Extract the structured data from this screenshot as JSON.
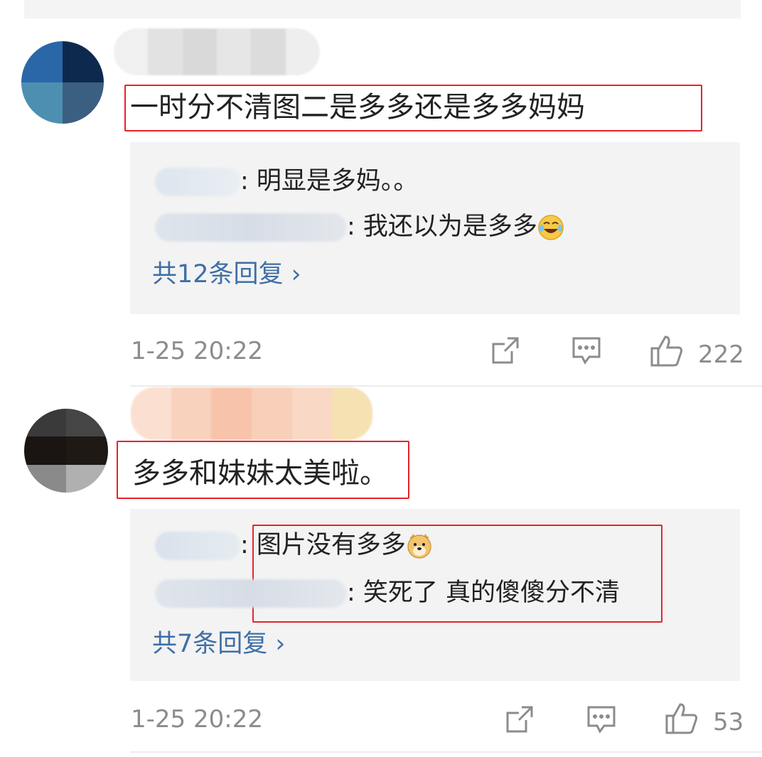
{
  "comments": [
    {
      "text": "一时分不清图二是多多还是多多妈妈",
      "replies": [
        {
          "text": ": 明显是多妈。。"
        },
        {
          "text": ": 我还以为是多多",
          "emoji": "laughing-crying-emoji"
        }
      ],
      "more_replies": "共12条回复 ›",
      "time": "1-25 20:22",
      "likes": "222",
      "icons": {
        "share": "share-icon",
        "comment": "comment-icon",
        "like": "thumbs-up-icon"
      }
    },
    {
      "text": "多多和妹妹太美啦。",
      "replies": [
        {
          "text": ": 图片没有多多",
          "emoji": "doge-emoji"
        },
        {
          "text": ": 笑死了 真的傻傻分不清"
        }
      ],
      "more_replies": "共7条回复 ›",
      "time": "1-25 20:22",
      "likes": "53",
      "icons": {
        "share": "share-icon",
        "comment": "comment-icon",
        "like": "thumbs-up-icon"
      }
    }
  ],
  "colors": {
    "highlight_border": "#e8232a",
    "link": "#3f6fa6",
    "meta": "#8c8c8c",
    "reply_bg": "#f3f3f3"
  }
}
